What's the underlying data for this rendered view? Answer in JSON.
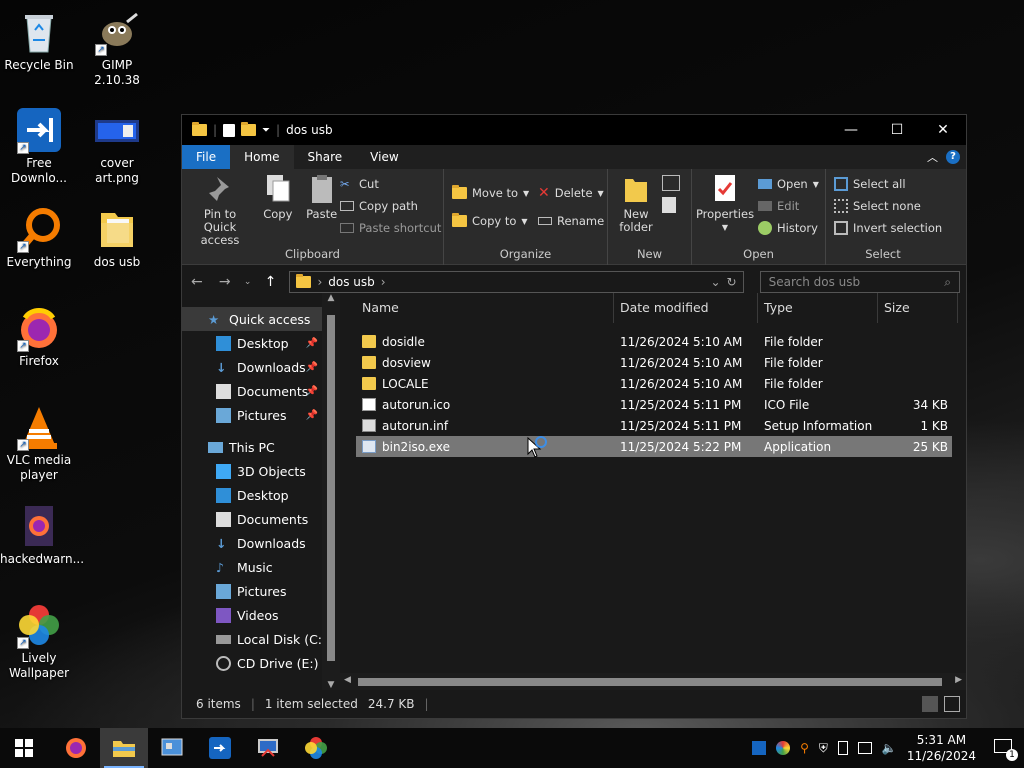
{
  "desktop": {
    "icons": [
      {
        "label": "Recycle Bin",
        "icon": "recycle-bin-icon"
      },
      {
        "label": "GIMP 2.10.38",
        "icon": "gimp-icon"
      },
      {
        "label": "Free Downlo...",
        "icon": "free-download-manager-icon"
      },
      {
        "label": "cover art.png",
        "icon": "image-file-icon"
      },
      {
        "label": "Everything",
        "icon": "everything-search-icon"
      },
      {
        "label": "dos usb",
        "icon": "folder-icon"
      },
      {
        "label": "Firefox",
        "icon": "firefox-icon"
      },
      {
        "label": "VLC media player",
        "icon": "vlc-icon"
      },
      {
        "label": "hackedwarn...",
        "icon": "firefox-html-file-icon"
      },
      {
        "label": "Lively Wallpaper",
        "icon": "lively-wallpaper-icon"
      }
    ]
  },
  "window": {
    "title": "dos usb",
    "tabs": [
      "File",
      "Home",
      "Share",
      "View"
    ],
    "active_tab": "Home",
    "ribbon": {
      "clipboard": {
        "label": "Clipboard",
        "pin": "Pin to Quick access",
        "copy": "Copy",
        "paste": "Paste",
        "cut": "Cut",
        "copy_path": "Copy path",
        "paste_shortcut": "Paste shortcut"
      },
      "organize": {
        "label": "Organize",
        "move_to": "Move to",
        "copy_to": "Copy to",
        "delete": "Delete",
        "rename": "Rename"
      },
      "new": {
        "label": "New",
        "new_folder": "New folder"
      },
      "open": {
        "label": "Open",
        "properties": "Properties",
        "open": "Open",
        "edit": "Edit",
        "history": "History"
      },
      "select": {
        "label": "Select",
        "select_all": "Select all",
        "select_none": "Select none",
        "invert": "Invert selection"
      }
    },
    "address": {
      "path": "dos usb",
      "search_placeholder": "Search dos usb"
    },
    "nav": {
      "quick_access": "Quick access",
      "quick_items": [
        {
          "label": "Desktop",
          "pinned": true
        },
        {
          "label": "Downloads",
          "pinned": true
        },
        {
          "label": "Documents",
          "pinned": true
        },
        {
          "label": "Pictures",
          "pinned": true
        }
      ],
      "this_pc": "This PC",
      "pc_items": [
        "3D Objects",
        "Desktop",
        "Documents",
        "Downloads",
        "Music",
        "Pictures",
        "Videos",
        "Local Disk (C:)",
        "CD Drive (E:) GP..."
      ]
    },
    "columns": [
      "Name",
      "Date modified",
      "Type",
      "Size"
    ],
    "files": [
      {
        "name": "dosidle",
        "date": "11/26/2024 5:10 AM",
        "type": "File folder",
        "size": "",
        "kind": "folder"
      },
      {
        "name": "dosview",
        "date": "11/26/2024 5:10 AM",
        "type": "File folder",
        "size": "",
        "kind": "folder"
      },
      {
        "name": "LOCALE",
        "date": "11/26/2024 5:10 AM",
        "type": "File folder",
        "size": "",
        "kind": "folder"
      },
      {
        "name": "autorun.ico",
        "date": "11/25/2024 5:11 PM",
        "type": "ICO File",
        "size": "34 KB",
        "kind": "ico"
      },
      {
        "name": "autorun.inf",
        "date": "11/25/2024 5:11 PM",
        "type": "Setup Information",
        "size": "1 KB",
        "kind": "inf"
      },
      {
        "name": "bin2iso.exe",
        "date": "11/25/2024 5:22 PM",
        "type": "Application",
        "size": "25 KB",
        "kind": "exe",
        "selected": true
      }
    ],
    "status": {
      "count": "6 items",
      "selected": "1 item selected",
      "size": "24.7 KB"
    }
  },
  "taskbar": {
    "time": "5:31 AM",
    "date": "11/26/2024",
    "notifications": "1"
  }
}
